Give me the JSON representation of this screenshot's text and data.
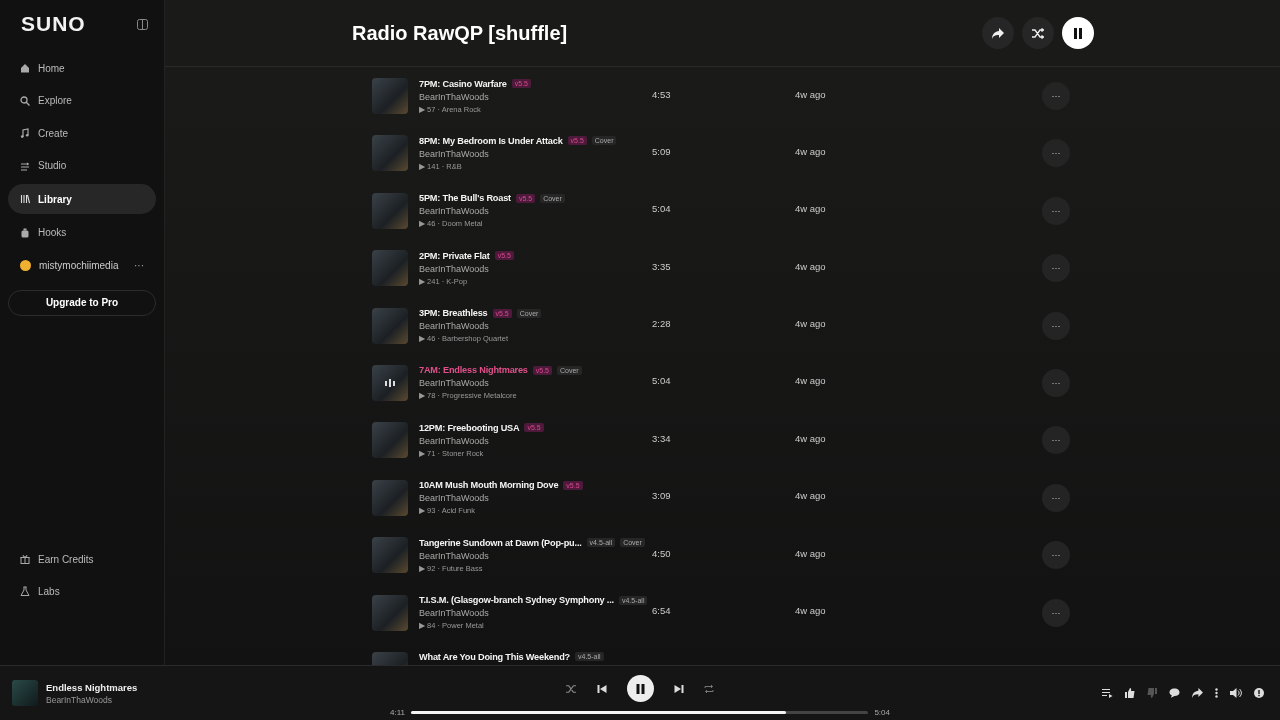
{
  "sidebar": {
    "logo": "SUNO",
    "items": [
      {
        "label": "Home",
        "selected": false
      },
      {
        "label": "Explore",
        "selected": false
      },
      {
        "label": "Create",
        "selected": false
      },
      {
        "label": "Studio",
        "selected": false
      },
      {
        "label": "Library",
        "selected": true
      },
      {
        "label": "Hooks",
        "selected": false
      }
    ],
    "user": {
      "name": "mistymochiimedia",
      "more": "···"
    },
    "upgrade": "Upgrade to Pro",
    "bottom_items": [
      {
        "label": "Earn Credits"
      },
      {
        "label": "Labs"
      }
    ]
  },
  "header": {
    "title": "Radio RawQP [shuffle]"
  },
  "songs": [
    {
      "title": "7PM: Casino Warfare",
      "tags": [
        {
          "text": "v5.5",
          "kind": "highlight"
        }
      ],
      "artist": "BearInThaWoods",
      "plays": "▶ 57 · Arena Rock",
      "duration": "4:53",
      "age": "4w ago",
      "playing": false,
      "more": "···"
    },
    {
      "title": "8PM: My Bedroom Is Under Attack",
      "tags": [
        {
          "text": "v5.5",
          "kind": "highlight"
        },
        {
          "text": "Cover",
          "kind": "plain"
        }
      ],
      "artist": "BearInThaWoods",
      "plays": "▶ 141 · R&B",
      "duration": "5:09",
      "age": "4w ago",
      "playing": false,
      "more": "···"
    },
    {
      "title": "5PM: The Bull's Roast",
      "tags": [
        {
          "text": "v5.5",
          "kind": "highlight"
        },
        {
          "text": "Cover",
          "kind": "plain"
        }
      ],
      "artist": "BearInThaWoods",
      "plays": "▶ 46 · Doom Metal",
      "duration": "5:04",
      "age": "4w ago",
      "playing": false,
      "more": "···"
    },
    {
      "title": "2PM: Private Flat",
      "tags": [
        {
          "text": "v5.5",
          "kind": "highlight"
        }
      ],
      "artist": "BearInThaWoods",
      "plays": "▶ 241 · K-Pop",
      "duration": "3:35",
      "age": "4w ago",
      "playing": false,
      "more": "···"
    },
    {
      "title": "3PM: Breathless",
      "tags": [
        {
          "text": "v5.5",
          "kind": "highlight"
        },
        {
          "text": "Cover",
          "kind": "plain"
        }
      ],
      "artist": "BearInThaWoods",
      "plays": "▶ 46 · Barbershop Quartet",
      "duration": "2:28",
      "age": "4w ago",
      "playing": false,
      "more": "···"
    },
    {
      "title": "7AM: Endless Nightmares",
      "tags": [
        {
          "text": "v5.5",
          "kind": "highlight"
        },
        {
          "text": "Cover",
          "kind": "plain"
        }
      ],
      "artist": "BearInThaWoods",
      "plays": "▶ 78 · Progressive Metalcore",
      "duration": "5:04",
      "age": "4w ago",
      "playing": true,
      "more": "···"
    },
    {
      "title": "12PM: Freebooting USA",
      "tags": [
        {
          "text": "v5.5",
          "kind": "highlight"
        }
      ],
      "artist": "BearInThaWoods",
      "plays": "▶ 71 · Stoner Rock",
      "duration": "3:34",
      "age": "4w ago",
      "playing": false,
      "more": "···"
    },
    {
      "title": "10AM Mush Mouth Morning Dove",
      "tags": [
        {
          "text": "v5.5",
          "kind": "highlight"
        }
      ],
      "artist": "BearInThaWoods",
      "plays": "▶ 93 · Acid Funk",
      "duration": "3:09",
      "age": "4w ago",
      "playing": false,
      "more": "···"
    },
    {
      "title": "Tangerine Sundown at Dawn (Pop-pu...",
      "tags": [
        {
          "text": "v4.5-all",
          "kind": "plain"
        },
        {
          "text": "Cover",
          "kind": "plain"
        }
      ],
      "artist": "BearInThaWoods",
      "plays": "▶ 92 · Future Bass",
      "duration": "4:50",
      "age": "4w ago",
      "playing": false,
      "more": "···"
    },
    {
      "title": "T.I.S.M. (Glasgow-branch Sydney Symphony ...",
      "tags": [
        {
          "text": "v4.5-all",
          "kind": "plain"
        }
      ],
      "artist": "BearInThaWoods",
      "plays": "▶ 84 · Power Metal",
      "duration": "6:54",
      "age": "4w ago",
      "playing": false,
      "more": "···"
    },
    {
      "title": "What Are You Doing This Weekend?",
      "tags": [
        {
          "text": "v4.5-all",
          "kind": "plain"
        }
      ]
    }
  ],
  "player": {
    "title": "Endless Nightmares",
    "artist": "BearInThaWoods",
    "elapsed": "4:11",
    "total": "5:04",
    "level": 0.82,
    "playing": true
  }
}
